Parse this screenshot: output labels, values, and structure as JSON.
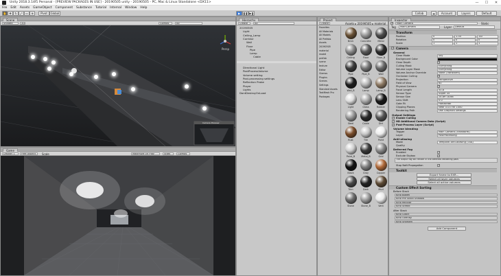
{
  "window": {
    "title": "Unity 2018.3.14f1 Personal - [PREVIEW PACKAGES IN USE] - 20190505 unity - 20190505 - PC, Mac & Linux Standalone <DX11>",
    "minimize": "—",
    "maximize": "☐",
    "close": "✕"
  },
  "menu": [
    "File",
    "Edit",
    "Assets",
    "GameObject",
    "Component",
    "Substance",
    "Tutorial",
    "Internal",
    "Window",
    "Help"
  ],
  "toolbar": {
    "pivot": "Pivot",
    "global": "Global",
    "play": "▶",
    "pause": "❚❚",
    "step": "▶❚",
    "collab": "Collab",
    "account": "Account",
    "layers": "Layers",
    "layout": "Default"
  },
  "scene": {
    "tab": "Scene",
    "shaded": "Shaded",
    "mode2d": "2D",
    "gizmos": "Gizmos",
    "search": "All",
    "persp": "Persp",
    "camera_preview": "Camera Preview"
  },
  "game": {
    "tab": "Game",
    "display": "Display 1",
    "aspect": "Free Aspect",
    "scale": "Scale",
    "maximize": "Maximize On Play",
    "stats": "Stats",
    "gizmos": "Gizmos"
  },
  "hierarchy": {
    "tab": "Hierarchy",
    "create": "Create",
    "search": "All",
    "items": [
      {
        "label": "20190505",
        "level": 0
      },
      {
        "label": "Light",
        "level": 1
      },
      {
        "label": "Ceiling_Lamp",
        "level": 1
      },
      {
        "label": "Corridor",
        "level": 1
      },
      {
        "label": "Wall",
        "level": 2
      },
      {
        "label": "Floor",
        "level": 2
      },
      {
        "label": "Pipe",
        "level": 3
      },
      {
        "label": "Lamp",
        "level": 3
      },
      {
        "label": "Cable",
        "level": 4
      },
      {
        "label": "Directional Light",
        "level": 1
      },
      {
        "label": "PostProcessVolume",
        "level": 1
      },
      {
        "label": "Volume setting",
        "level": 1
      },
      {
        "label": "Post-processing settings",
        "level": 1
      },
      {
        "label": "Reflection Probe",
        "level": 1
      },
      {
        "label": "Player",
        "level": 1
      },
      {
        "label": "Lights",
        "level": 1
      },
      {
        "label": "DontDestroyOnLoad",
        "level": 0
      }
    ]
  },
  "project": {
    "tab": "Project",
    "create": "Create",
    "breadcrumb": [
      "Assets",
      "20190505",
      "material"
    ],
    "tree": [
      "Favorites",
      "All Materials",
      "All Models",
      "All Prefabs",
      "Assets",
      "20190505",
      "material",
      "model",
      "prefab",
      "scene",
      "texture",
      "Editor",
      "Gizmos",
      "Plugins",
      "Scenes",
      "Settings",
      "Standard Assets",
      "TextMesh Pro",
      "Packages"
    ],
    "materials": [
      "Brick",
      "Concrete",
      "Metal",
      "Ceiling",
      "Floor",
      "Floor_B",
      "Pipe",
      "Pipe_B",
      "Wall",
      "Wall_B",
      "Lamp",
      "Lamp_B",
      "Light",
      "Glass",
      "Rubber",
      "Steel",
      "Cable",
      "Dirt",
      "Rust",
      "Tile",
      "Paint",
      "Paint_B",
      "Metal_B",
      "Grid",
      "Black",
      "Gray",
      "Copper",
      "Trim",
      "Dark",
      "Mud",
      "Stone",
      "Stone_B",
      "Vent"
    ]
  },
  "inspector": {
    "tab": "Inspector",
    "object_name": "Main Camera",
    "static": "Static",
    "tag_label": "Tag",
    "tag_value": "MainCamera",
    "layer_label": "Layer",
    "layer_value": "Default",
    "transform": {
      "header": "Transform",
      "rows": [
        {
          "label": "Position",
          "x": "0",
          "y": "1.35",
          "z": "-40"
        },
        {
          "label": "Rotation",
          "x": "0",
          "y": "0",
          "z": "0"
        },
        {
          "label": "Scale",
          "x": "1",
          "y": "1",
          "z": "1"
        }
      ]
    },
    "camera": {
      "header": "Camera",
      "general": "General",
      "rows": [
        {
          "label": "Clear Mode",
          "value": "Sky"
        },
        {
          "label": "Background Color",
          "value": ""
        },
        {
          "label": "Clear Depth",
          "value": ""
        },
        {
          "label": "Culling Mask",
          "value": "Everything"
        },
        {
          "label": "Volume Layer Mask",
          "value": "Everything"
        },
        {
          "label": "Volume Anchor Override",
          "value": "None (Transform)"
        },
        {
          "label": "Occlusion Culling",
          "value": ""
        },
        {
          "label": "Projection",
          "value": "Perspective"
        },
        {
          "label": "Field of View",
          "value": "60"
        },
        {
          "label": "Physical Camera",
          "value": ""
        },
        {
          "label": "Focal Length",
          "value": "50.8"
        },
        {
          "label": "Sensor Type",
          "value": "Super 35"
        },
        {
          "label": "Sensor Size",
          "value": "24.89  18.66"
        },
        {
          "label": "Lens Shift",
          "value": "0  0"
        },
        {
          "label": "Gate Fit",
          "value": "Horizontal"
        },
        {
          "label": "Clipping Planes",
          "value": "Near 0.03  Far 1000"
        },
        {
          "label": "Rendering Path",
          "value": "Use Graphics Settings"
        }
      ],
      "output": "Output Settings",
      "output_rows": [
        {
          "label": "Enable Culling",
          "value": ""
        },
        {
          "label": "HD Additional Camera Data (Script)",
          "value": ""
        },
        {
          "label": "Post-Process Layer (Script)",
          "value": ""
        }
      ]
    },
    "postprocess": {
      "volume_blending": "Volume blending",
      "trigger_label": "Trigger",
      "trigger_value": "Main Camera (Transform)",
      "layer_label": "Layer",
      "layer_value": "PostProcessing",
      "antialiasing": "Anti-aliasing",
      "mode_label": "Mode",
      "mode_value": "Temporal Anti-aliasing (TAA)",
      "quality_label": "Quality",
      "deferred_fog": "Deferred Fog",
      "enabled_label": "Enabled",
      "skybox_label": "Exclude Skybox",
      "fog_note": "The output fog will render in the deferred rendering path.",
      "stop_nan": "Stop NaN Propagation",
      "toolkit": "Toolkit",
      "toolkit_buttons": [
        "Export frame to EXR...",
        "Select all layer volumes",
        "Select all active volumes"
      ],
      "custom_effect": "Custom Effect Sorting",
      "before_stack": "Before Stack",
      "before_items": [
        "Kino Bokeh",
        "Kino Pre Stack Shadow",
        "Kino Recolor",
        "Kino Streak"
      ],
      "after_stack": "After Stack",
      "after_items": [
        "Kino Glitch",
        "Kino Overlay",
        "Kino Sharpen"
      ],
      "add_component": "Add Component"
    }
  }
}
